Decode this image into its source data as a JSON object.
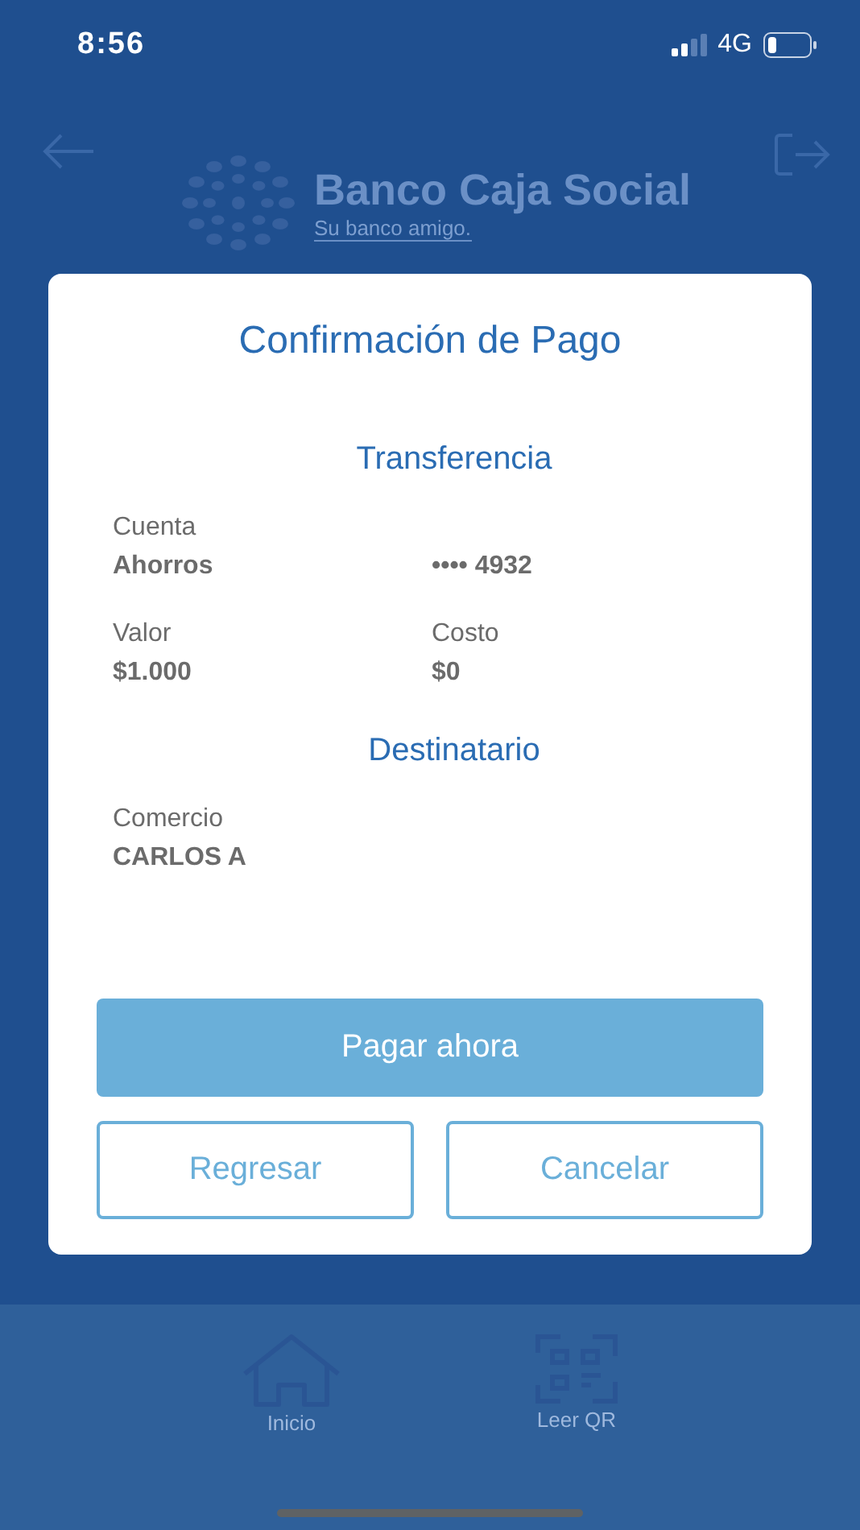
{
  "status_bar": {
    "time": "8:56",
    "network": "4G"
  },
  "header": {
    "logo_name": "Banco Caja Social",
    "logo_tagline": "Su banco amigo."
  },
  "dialog": {
    "title": "Confirmación de Pago",
    "sections": [
      {
        "heading": "Transferencia",
        "fields": [
          {
            "label": "Cuenta",
            "value": "Ahorros"
          },
          {
            "value": "•••• 4932"
          },
          {
            "label": "Valor",
            "value": "$1.000"
          },
          {
            "label": "Costo",
            "value": "$0"
          }
        ]
      },
      {
        "heading": "Destinatario",
        "fields": [
          {
            "label": "Comercio",
            "value": "CARLOS A"
          }
        ]
      }
    ],
    "primary_button": "Pagar ahora",
    "secondary_buttons": [
      "Regresar",
      "Cancelar"
    ]
  },
  "bottom_nav": [
    {
      "kind": "home",
      "label": "Inicio"
    },
    {
      "kind": "qr",
      "label": "Leer QR"
    }
  ]
}
